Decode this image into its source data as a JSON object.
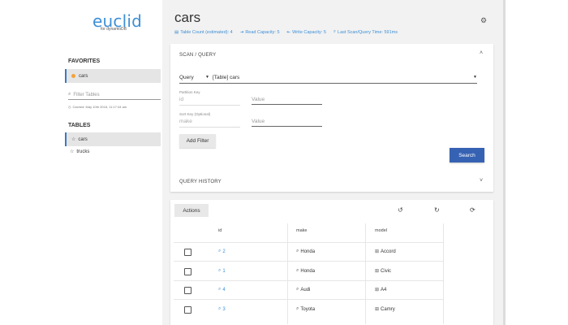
{
  "app": {
    "logo": "euclid",
    "logo_sub": "for dynamoDB"
  },
  "sidebar": {
    "favorites_head": "FAVORITES",
    "favorites": [
      {
        "label": "cars"
      }
    ],
    "filter_placeholder": "Filter Tables",
    "cached": "Cached: May 10th 2018, 11:17:44 am",
    "tables_head": "TABLES",
    "tables": [
      {
        "label": "cars"
      },
      {
        "label": "trucks"
      }
    ]
  },
  "header": {
    "title": "cars",
    "stats": [
      {
        "icon": "table-icon",
        "label": "Table Count (estimated): 4"
      },
      {
        "icon": "read-icon",
        "label": "Read Capacity: 5"
      },
      {
        "icon": "write-icon",
        "label": "Write Capacity: 5"
      },
      {
        "icon": "search-icon",
        "label": "Last Scan/Query Time: 591ms"
      }
    ]
  },
  "query": {
    "head": "SCAN / QUERY",
    "mode": "Query",
    "table": "[Table] cars",
    "partition_label": "Partition Key",
    "partition_key": "id",
    "sort_label": "Sort Key (Optional)",
    "sort_key": "make",
    "value_placeholder": "Value",
    "add_filter": "Add Filter",
    "search": "Search",
    "history_head": "QUERY HISTORY"
  },
  "results": {
    "actions": "Actions",
    "columns": [
      "id",
      "make",
      "model"
    ],
    "rows": [
      {
        "id": "2",
        "make": "Honda",
        "model": "Accord"
      },
      {
        "id": "1",
        "make": "Honda",
        "model": "Civic"
      },
      {
        "id": "4",
        "make": "Audi",
        "model": "A4"
      },
      {
        "id": "3",
        "make": "Toyota",
        "model": "Camry"
      }
    ]
  },
  "colors": {
    "accent": "#3e8fd6",
    "primary_button": "#3662b3",
    "favorite_dot": "#f2a33a"
  }
}
